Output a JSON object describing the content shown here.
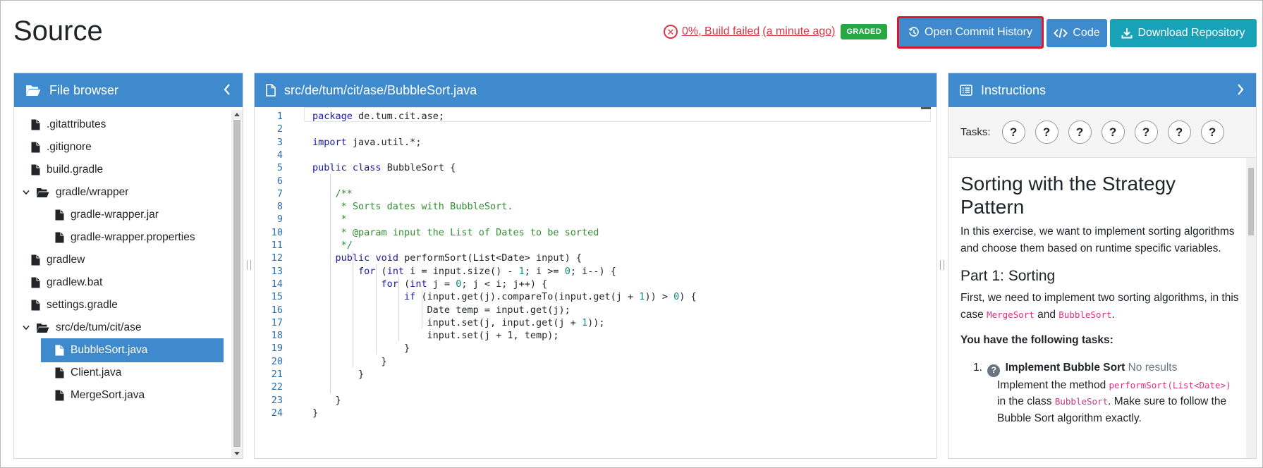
{
  "header": {
    "title": "Source",
    "build_result": "0%, Build failed",
    "build_time": "(a minute ago)",
    "graded_badge": "GRADED",
    "open_commit_history": "Open Commit History",
    "code_button": "Code",
    "download_repository": "Download Repository"
  },
  "colors": {
    "primary": "#3e8acc",
    "info": "#17a2b8",
    "success": "#28a745",
    "danger": "#dc3545",
    "highlight_border": "#e0142a"
  },
  "file_browser": {
    "title": "File browser",
    "items": [
      {
        "name": ".gitattributes",
        "type": "file",
        "depth": 0
      },
      {
        "name": ".gitignore",
        "type": "file",
        "depth": 0
      },
      {
        "name": "build.gradle",
        "type": "file",
        "depth": 0
      },
      {
        "name": "gradle/wrapper",
        "type": "folder",
        "depth": 0
      },
      {
        "name": "gradle-wrapper.jar",
        "type": "file",
        "depth": 1
      },
      {
        "name": "gradle-wrapper.properties",
        "type": "file",
        "depth": 1
      },
      {
        "name": "gradlew",
        "type": "file",
        "depth": 0
      },
      {
        "name": "gradlew.bat",
        "type": "file",
        "depth": 0
      },
      {
        "name": "settings.gradle",
        "type": "file",
        "depth": 0
      },
      {
        "name": "src/de/tum/cit/ase",
        "type": "folder",
        "depth": 0
      },
      {
        "name": "BubbleSort.java",
        "type": "file",
        "depth": 1,
        "selected": true
      },
      {
        "name": "Client.java",
        "type": "file",
        "depth": 1
      },
      {
        "name": "MergeSort.java",
        "type": "file",
        "depth": 1
      }
    ]
  },
  "editor": {
    "file_path": "src/de/tum/cit/ase/BubbleSort.java",
    "lines": [
      "package de.tum.cit.ase;",
      "",
      "import java.util.*;",
      "",
      "public class BubbleSort {",
      "",
      "    /**",
      "     * Sorts dates with BubbleSort.",
      "     *",
      "     * @param input the List of Dates to be sorted",
      "     */",
      "    public void performSort(List<Date> input) {",
      "        for (int i = input.size() - 1; i >= 0; i--) {",
      "            for (int j = 0; j < i; j++) {",
      "                if (input.get(j).compareTo(input.get(j + 1)) > 0) {",
      "                    Date temp = input.get(j);",
      "                    input.set(j, input.get(j + 1));",
      "                    input.set(j + 1, temp);",
      "                }",
      "            }",
      "        }",
      "",
      "    }",
      "}"
    ]
  },
  "instructions": {
    "title": "Instructions",
    "tasks_label": "Tasks:",
    "task_chips": [
      "?",
      "?",
      "?",
      "?",
      "?",
      "?",
      "?"
    ],
    "heading": "Sorting with the Strategy Pattern",
    "intro": "In this exercise, we want to implement sorting algorithms and choose them based on runtime specific variables.",
    "part1_heading": "Part 1: Sorting",
    "part1_text_a": "First, we need to implement two sorting algorithms, in this case ",
    "part1_code_a": "MergeSort",
    "part1_text_b": " and ",
    "part1_code_b": "BubbleSort",
    "part1_text_c": ".",
    "tasks_heading": "You have the following tasks:",
    "task1_number": "1.",
    "task1_badge": "?",
    "task1_title": "Implement Bubble Sort",
    "task1_status": "No results",
    "task1_text_a": "Implement the method ",
    "task1_code_a": "performSort(List<Date>)",
    "task1_text_b": " in the class ",
    "task1_code_b": "BubbleSort",
    "task1_text_c": ". Make sure to follow the Bubble Sort algorithm exactly."
  }
}
